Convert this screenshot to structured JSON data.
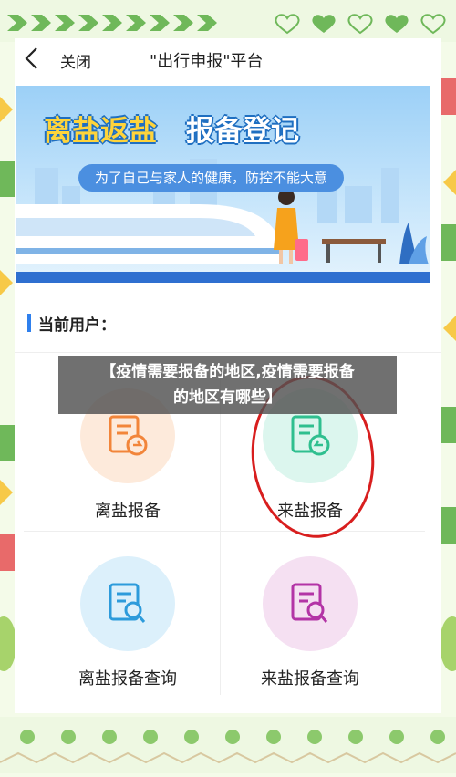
{
  "header": {
    "back_icon": "chevron-left-icon",
    "close_label": "关闭",
    "title": "\"出行申报\"平台"
  },
  "banner": {
    "title_part1": "离盐返盐",
    "title_part2": "报备登记",
    "subtitle": "为了自己与家人的健康，防控不能大意"
  },
  "user": {
    "label": "当前用户："
  },
  "tiles": [
    {
      "label": "离盐报备",
      "icon": "document-arrow-right-icon",
      "color": "#f2853a",
      "bg": "#fdeadb"
    },
    {
      "label": "来盐报备",
      "icon": "document-arrow-left-icon",
      "color": "#2fbf8f",
      "bg": "#dcf6ee"
    },
    {
      "label": "离盐报备查询",
      "icon": "document-search-icon",
      "color": "#2d9bdb",
      "bg": "#dcf0fb"
    },
    {
      "label": "来盐报备查询",
      "icon": "document-search-icon",
      "color": "#b334a6",
      "bg": "#f5e0f2"
    }
  ],
  "overlay": {
    "line1": "【疫情需要报备的地区,疫情需要报备",
    "line2": "的地区有哪些】"
  },
  "colors": {
    "accent": "#2f80ed",
    "annotation": "#d81e1e"
  }
}
